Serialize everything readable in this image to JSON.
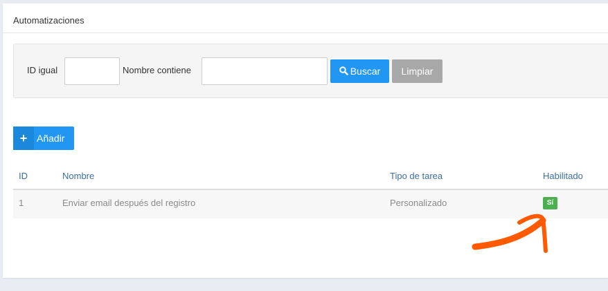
{
  "panel": {
    "title": "Automatizaciones"
  },
  "filters": {
    "id_label": "ID igual",
    "id_value": "",
    "name_label": "Nombre contiene",
    "name_value": "",
    "search_label": "Buscar",
    "clear_label": "Limpiar"
  },
  "actions": {
    "add_label": "Añadir",
    "add_icon": "+"
  },
  "table": {
    "columns": [
      "ID",
      "Nombre",
      "Tipo de tarea",
      "Habilitado"
    ],
    "rows": [
      {
        "id": "1",
        "name": "Enviar email después del registro",
        "type": "Personalizado",
        "enabled": "Sí"
      }
    ]
  },
  "colors": {
    "primary": "#2196f3",
    "secondary": "#a8a8a8",
    "success": "#4caf50",
    "annotation": "#ff5a00",
    "header_text": "#3c6fa5"
  }
}
